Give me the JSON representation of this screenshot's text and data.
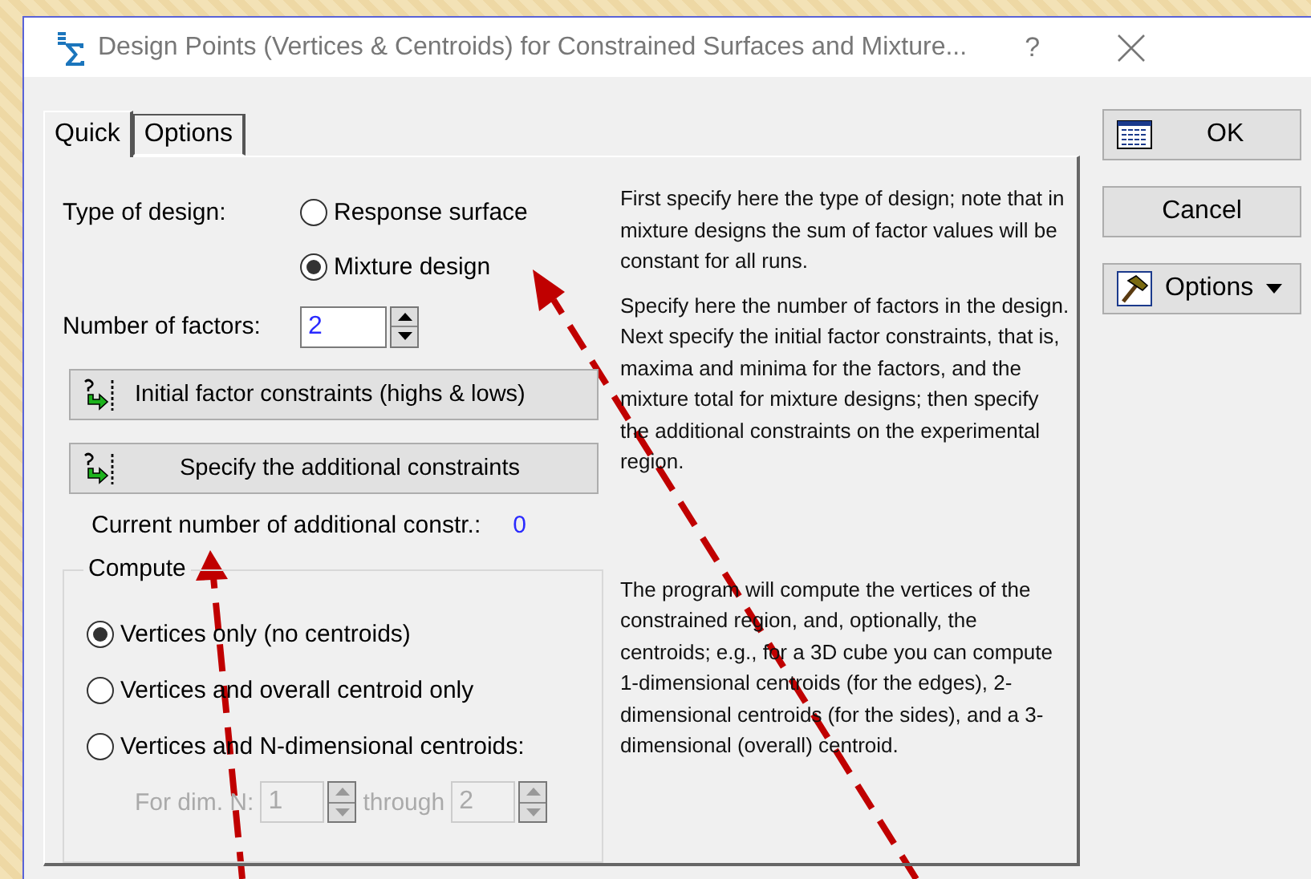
{
  "window": {
    "title": "Design Points (Vertices & Centroids) for Constrained Surfaces and Mixture...",
    "help_button": "?"
  },
  "tabs": [
    {
      "label": "Quick",
      "selected": true
    },
    {
      "label": "Options",
      "selected": false
    }
  ],
  "design_type": {
    "label": "Type of design:",
    "options": [
      {
        "label": "Response surface",
        "selected": false
      },
      {
        "label": "Mixture design",
        "selected": true
      }
    ]
  },
  "factors": {
    "label": "Number of factors:",
    "value": "2"
  },
  "constraint_buttons": [
    {
      "label": "Initial factor constraints (highs & lows)"
    },
    {
      "label": "Specify the additional constraints"
    }
  ],
  "additional_count": {
    "label": "Current number of additional constr.:",
    "value": "0"
  },
  "compute": {
    "title": "Compute",
    "options": [
      {
        "label": "Vertices only (no centroids)",
        "selected": true
      },
      {
        "label": "Vertices and overall centroid only",
        "selected": false
      },
      {
        "label": "Vertices and N-dimensional centroids:",
        "selected": false
      }
    ],
    "range": {
      "label": "For dim. N:",
      "from": "1",
      "through_label": "through",
      "to": "2",
      "disabled": true
    }
  },
  "help_texts": [
    "First specify here the type of design; note that in mixture designs the sum of factor values will be constant for all runs.",
    "Specify here  the number of factors in the design.",
    "Next specify the initial factor constraints, that is, maxima and minima for the factors, and the mixture total for mixture designs; then specify the additional constraints on the experimental region.",
    "The program will compute the vertices of the constrained region, and, optionally, the centroids; e.g., for a 3D cube you can compute 1-dimensional centroids (for the edges), 2-dimensional centroids (for the sides), and a 3-dimensional (overall) centroid."
  ],
  "side_buttons": [
    {
      "label": "OK",
      "kind": "ok"
    },
    {
      "label": "Cancel",
      "kind": "plain"
    },
    {
      "label": "Options",
      "kind": "menu"
    }
  ]
}
